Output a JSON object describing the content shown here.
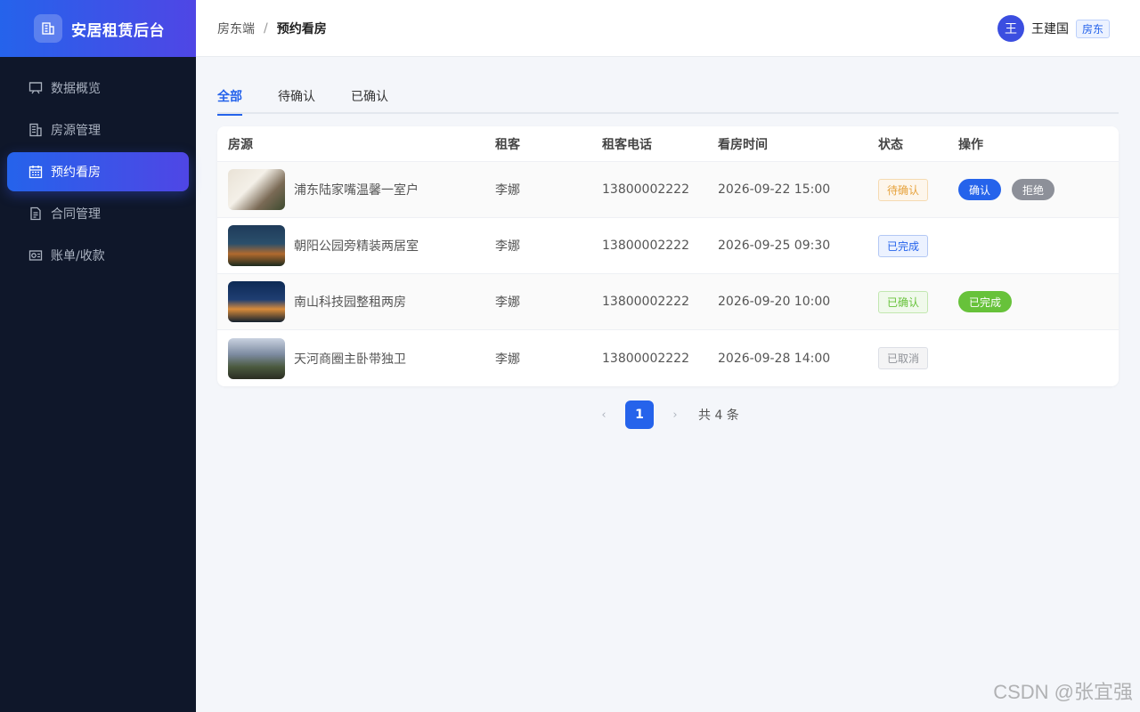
{
  "app": {
    "title": "安居租赁后台"
  },
  "sidebar": {
    "items": [
      {
        "label": "数据概览",
        "icon": "dashboard-icon"
      },
      {
        "label": "房源管理",
        "icon": "building-icon"
      },
      {
        "label": "预约看房",
        "icon": "calendar-icon",
        "active": true
      },
      {
        "label": "合同管理",
        "icon": "document-icon"
      },
      {
        "label": "账单/收款",
        "icon": "wallet-icon"
      }
    ]
  },
  "header": {
    "breadcrumb": {
      "parent": "房东端",
      "separator": "/",
      "current": "预约看房"
    },
    "user": {
      "avatar_text": "王",
      "name": "王建国",
      "role": "房东"
    }
  },
  "tabs": [
    {
      "label": "全部",
      "active": true
    },
    {
      "label": "待确认"
    },
    {
      "label": "已确认"
    }
  ],
  "table": {
    "headers": [
      "房源",
      "租客",
      "租客电话",
      "看房时间",
      "状态",
      "操作"
    ],
    "rows": [
      {
        "house": "浦东陆家嘴温馨一室户",
        "tenant": "李娜",
        "phone": "13800002222",
        "time": "2026-09-22 15:00",
        "status": "待确认",
        "status_type": "pending",
        "actions": [
          "确认",
          "拒绝"
        ]
      },
      {
        "house": "朝阳公园旁精装两居室",
        "tenant": "李娜",
        "phone": "13800002222",
        "time": "2026-09-25 09:30",
        "status": "已完成",
        "status_type": "done",
        "actions": []
      },
      {
        "house": "南山科技园整租两房",
        "tenant": "李娜",
        "phone": "13800002222",
        "time": "2026-09-20 10:00",
        "status": "已确认",
        "status_type": "confirmed",
        "actions": [
          "已完成"
        ]
      },
      {
        "house": "天河商圈主卧带独卫",
        "tenant": "李娜",
        "phone": "13800002222",
        "time": "2026-09-28 14:00",
        "status": "已取消",
        "status_type": "cancel",
        "actions": []
      }
    ]
  },
  "pagination": {
    "prev": "‹",
    "current_page": "1",
    "next": "›",
    "total": "共 4 条"
  },
  "watermark": "CSDN @张宜强",
  "colors": {
    "primary": "#2563eb",
    "sidebar_bg": "#0f172a",
    "success": "#67c23a",
    "warning": "#e6a23c"
  }
}
